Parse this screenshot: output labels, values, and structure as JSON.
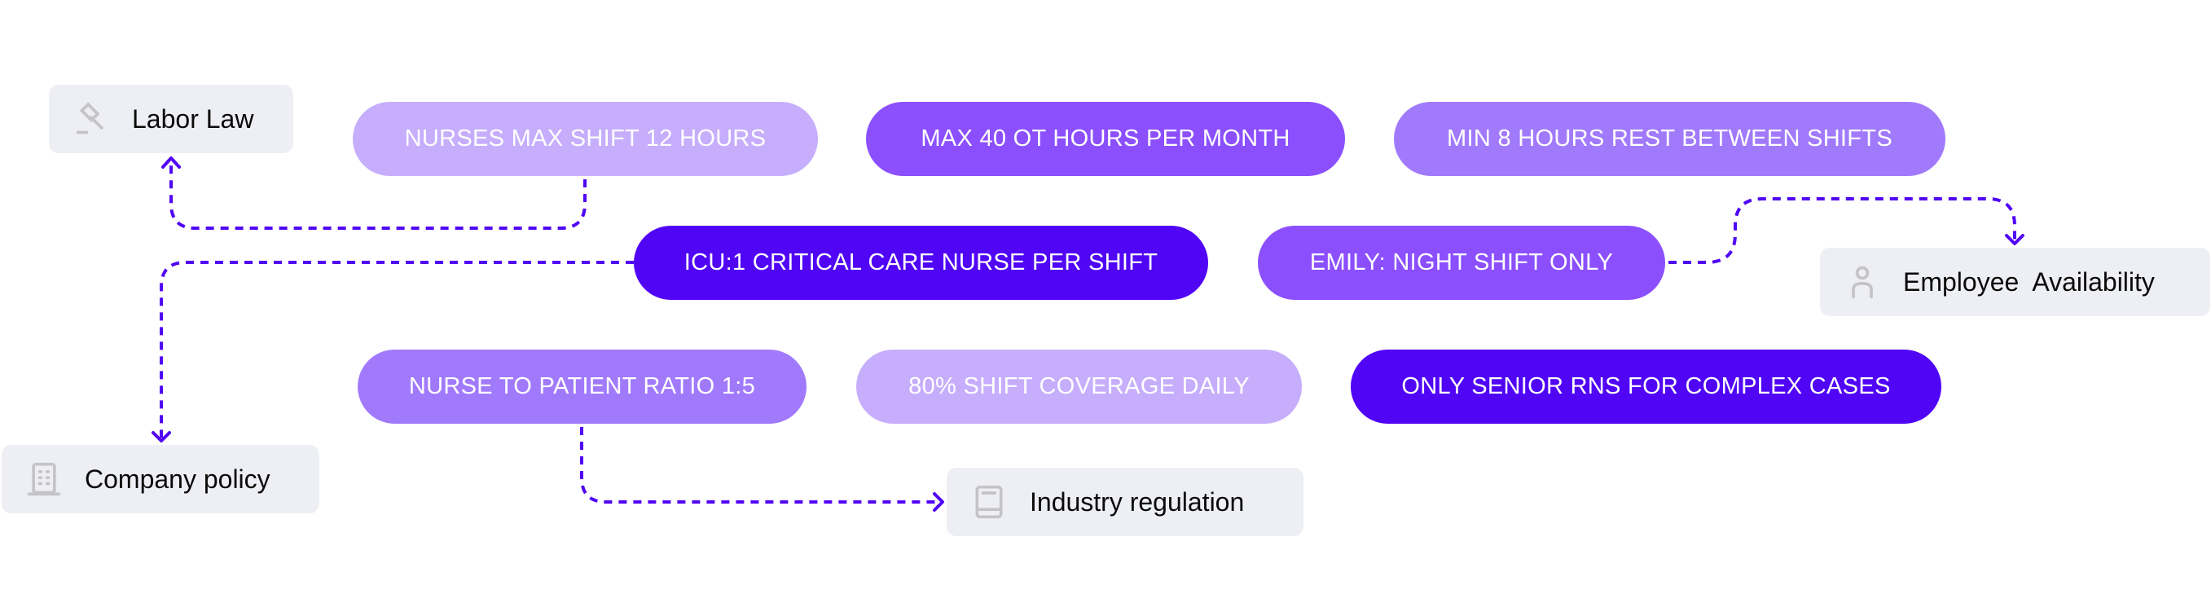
{
  "colors": {
    "connector": "#5005f5",
    "source_bg": "#eeeff4",
    "source_icon": "#c4c4c6",
    "pill_light": "#c6aefc",
    "pill_mid": "#a17afc",
    "pill_strong": "#8b4ffe",
    "pill_dark": "#5005f5"
  },
  "sources": {
    "labor_law": {
      "label": "Labor Law",
      "icon": "gavel-icon"
    },
    "company_policy": {
      "label": "Company policy",
      "icon": "building-icon"
    },
    "industry_regulation": {
      "label": "Industry regulation",
      "icon": "book-icon"
    },
    "employee_availability": {
      "label": "Employee  Availability",
      "icon": "person-icon"
    }
  },
  "constraints": [
    {
      "label": "NURSES MAX SHIFT 12 HOURS",
      "tone": "light",
      "source": "Labor Law"
    },
    {
      "label": "MAX 40 OT HOURS PER MONTH",
      "tone": "strong"
    },
    {
      "label": "MIN 8 HOURS REST BETWEEN SHIFTS",
      "tone": "mid"
    },
    {
      "label": "ICU:1 CRITICAL CARE NURSE PER SHIFT",
      "tone": "dark",
      "source": "Company policy"
    },
    {
      "label": "EMILY: NIGHT SHIFT ONLY",
      "tone": "strong",
      "source": "Employee  Availability"
    },
    {
      "label": "NURSE TO PATIENT RATIO 1:5",
      "tone": "mid",
      "source": "Industry regulation"
    },
    {
      "label": "80% SHIFT COVERAGE DAILY",
      "tone": "light"
    },
    {
      "label": "ONLY SENIOR RNS FOR COMPLEX CASES",
      "tone": "dark"
    }
  ]
}
